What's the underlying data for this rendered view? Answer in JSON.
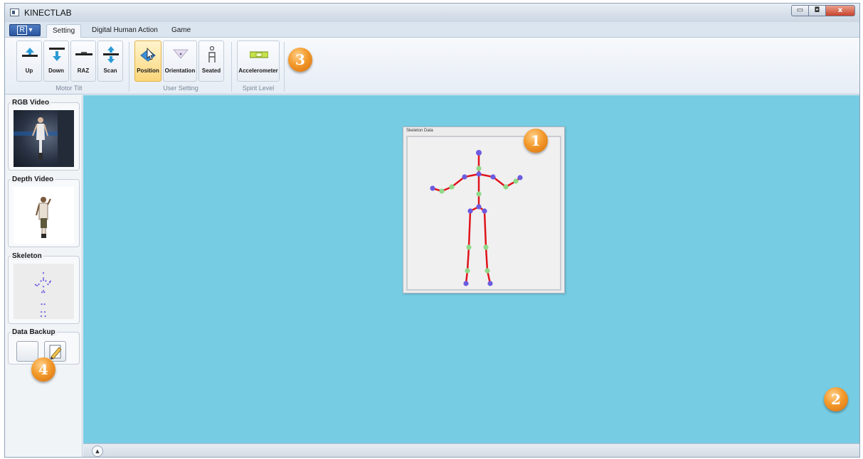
{
  "window": {
    "title": "KINECTLAB",
    "minimize_glyph": "▭",
    "maximize_glyph": "◘",
    "close_glyph": "x"
  },
  "ribbon_tabs": {
    "app_menu_glyph": "R",
    "app_menu_arrow": "▾",
    "tabs": [
      {
        "label": "Setting",
        "active": true
      },
      {
        "label": "Digital Human Action",
        "active": false
      },
      {
        "label": "Game",
        "active": false
      }
    ]
  },
  "ribbon": {
    "motor_tilt": {
      "label": "Motor Tilt",
      "buttons": [
        {
          "label": "Up",
          "icon": "tilt-up-icon"
        },
        {
          "label": "Down",
          "icon": "tilt-down-icon"
        },
        {
          "label": "RAZ",
          "icon": "tilt-reset-icon"
        },
        {
          "label": "Scan",
          "icon": "tilt-scan-icon"
        }
      ]
    },
    "user_setting": {
      "label": "User Setting",
      "buttons": [
        {
          "label": "Position",
          "icon": "position-icon",
          "selected": true
        },
        {
          "label": "Orientation",
          "icon": "orientation-icon",
          "selected": false
        },
        {
          "label": "Seated",
          "icon": "seated-icon",
          "selected": false
        }
      ]
    },
    "spirit_level": {
      "label": "Spirit Level",
      "buttons": [
        {
          "label": "Accelerometer",
          "icon": "spirit-level-icon"
        }
      ]
    }
  },
  "sidebar": {
    "rgb_video": {
      "title": "RGB Video"
    },
    "depth_video": {
      "title": "Depth Video"
    },
    "skeleton": {
      "title": "Skeleton"
    },
    "data_backup": {
      "title": "Data Backup"
    }
  },
  "workspace": {
    "skeleton_window_title": "Skeleton Data",
    "expand_glyph": "▲"
  },
  "callouts": [
    "1",
    "2",
    "3",
    "4"
  ],
  "colors": {
    "workspace_bg": "#76cce3",
    "bone": "#e0141b",
    "joint_end": "#6b5ce0",
    "joint_mid": "#8fd98a",
    "badge": "#f39a2c"
  }
}
